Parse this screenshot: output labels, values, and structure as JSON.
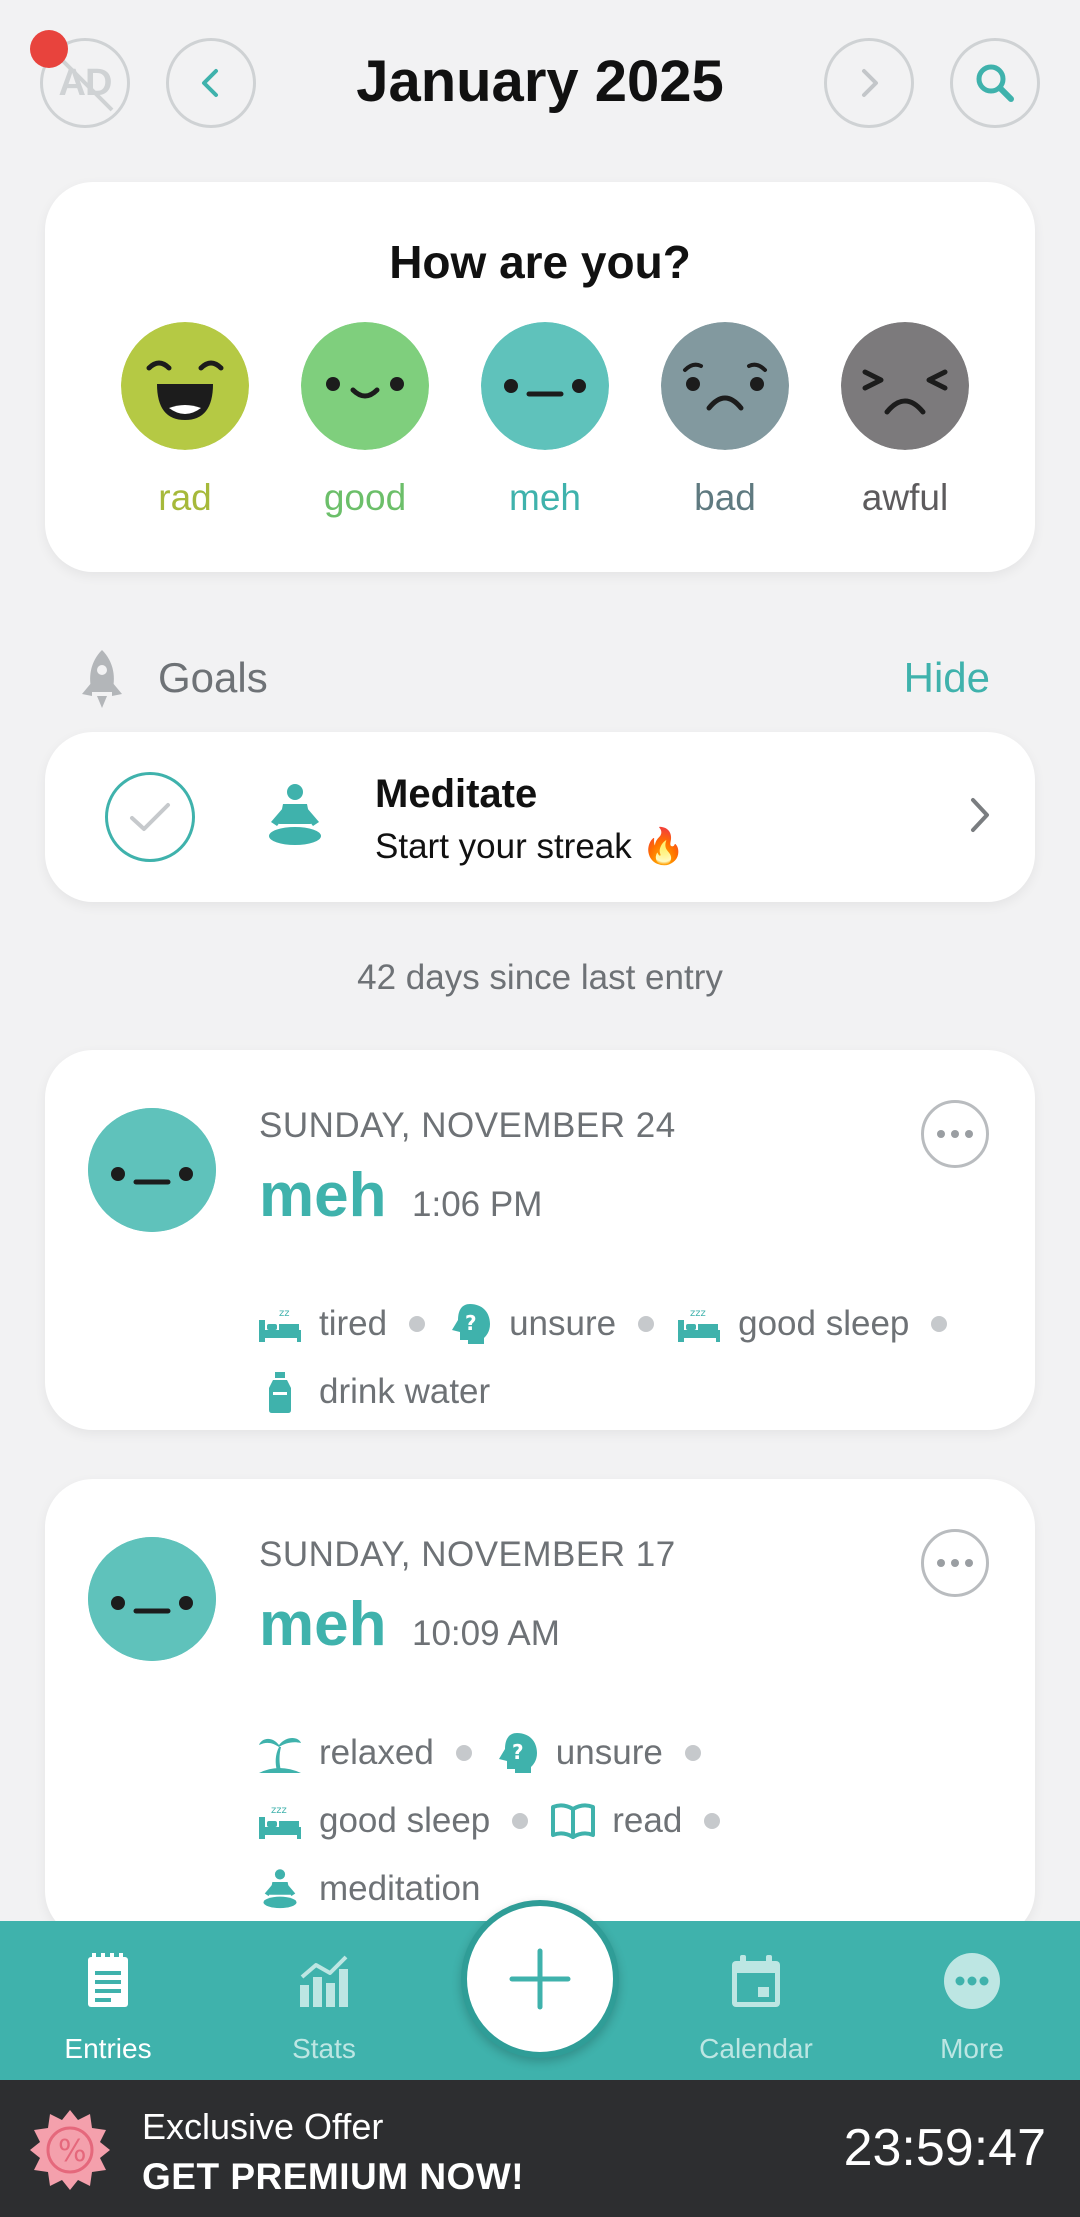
{
  "header": {
    "ad_label": "AD",
    "title": "January 2025"
  },
  "mood_prompt": {
    "question": "How are you?",
    "moods": [
      {
        "label": "rad",
        "color": "#b5c944"
      },
      {
        "label": "good",
        "color": "#7fcf7d"
      },
      {
        "label": "meh",
        "color": "#5fc2bb"
      },
      {
        "label": "bad",
        "color": "#82999f"
      },
      {
        "label": "awful",
        "color": "#7c7a7c"
      }
    ]
  },
  "goals": {
    "section_label": "Goals",
    "hide_label": "Hide",
    "items": [
      {
        "title": "Meditate",
        "subtitle": "Start your streak 🔥"
      }
    ]
  },
  "since_text": "42 days since last entry",
  "entries": [
    {
      "date": "SUNDAY, NOVEMBER 24",
      "mood": "meh",
      "time": "1:06 PM",
      "tags": [
        "tired",
        "unsure",
        "good sleep",
        "drink water"
      ]
    },
    {
      "date": "SUNDAY, NOVEMBER 17",
      "mood": "meh",
      "time": "10:09 AM",
      "tags": [
        "relaxed",
        "unsure",
        "good sleep",
        "read",
        "meditation"
      ]
    }
  ],
  "nav": {
    "items": [
      {
        "label": "Entries",
        "icon": "entries-icon",
        "active": true
      },
      {
        "label": "Stats",
        "icon": "stats-icon"
      },
      {
        "label": "Calendar",
        "icon": "calendar-icon"
      },
      {
        "label": "More",
        "icon": "more-icon"
      }
    ],
    "fab_icon": "plus-icon"
  },
  "promo": {
    "line1": "Exclusive Offer",
    "line2": "GET PREMIUM NOW!",
    "timer": "23:59:47",
    "badge_icon": "percent-badge-icon"
  },
  "colors": {
    "accent": "#3fb2ac",
    "background": "#f2f2f3"
  }
}
